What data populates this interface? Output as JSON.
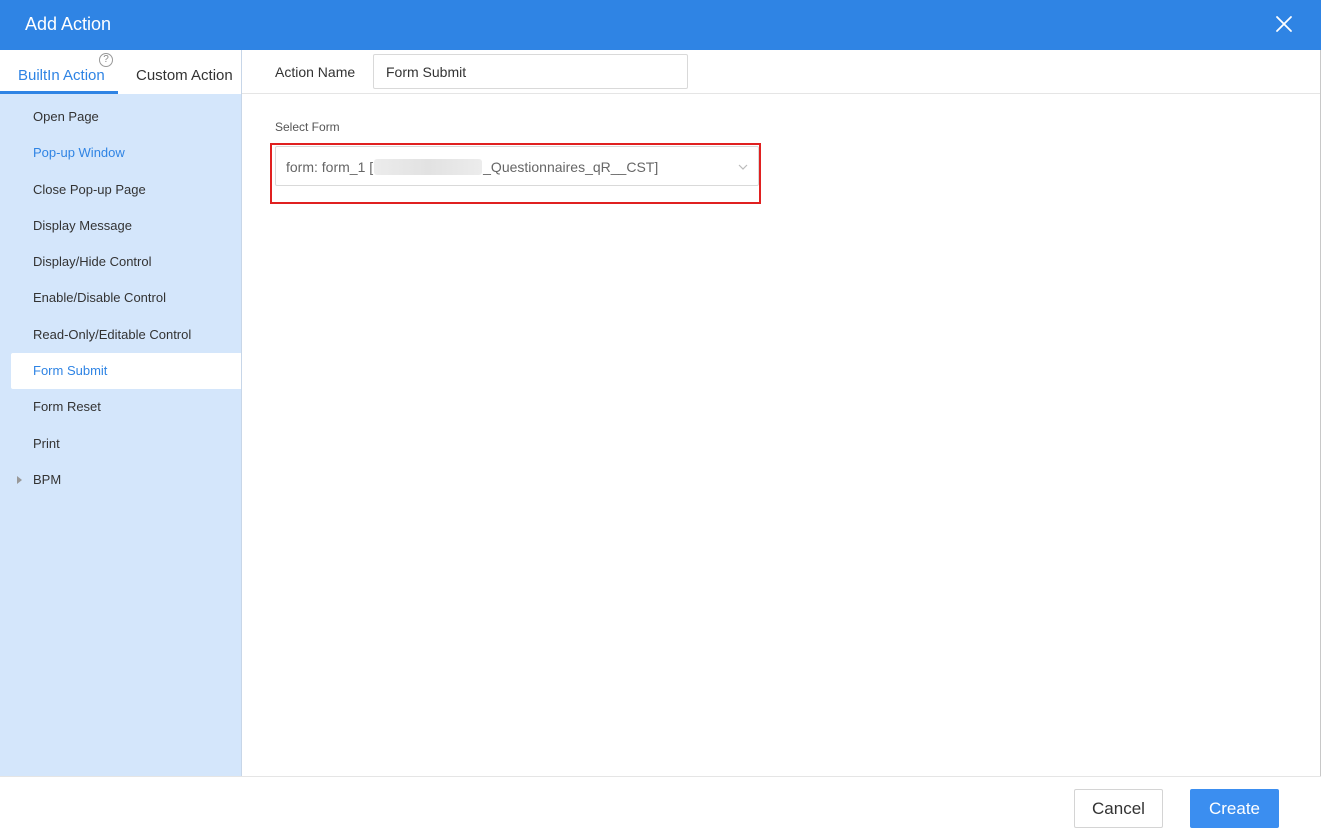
{
  "dialog": {
    "title": "Add Action",
    "close_icon": "close-icon"
  },
  "sidebar": {
    "tabs": [
      {
        "label": "BuiltIn Action",
        "active": true
      },
      {
        "label": "Custom Action",
        "active": false
      }
    ],
    "help_glyph": "?",
    "items": [
      {
        "label": "Open Page"
      },
      {
        "label": "Pop-up Window"
      },
      {
        "label": "Close Pop-up Page"
      },
      {
        "label": "Display Message"
      },
      {
        "label": "Display/Hide Control"
      },
      {
        "label": "Enable/Disable Control"
      },
      {
        "label": "Read-Only/Editable Control"
      },
      {
        "label": "Form Submit",
        "selected": true
      },
      {
        "label": "Form Reset"
      },
      {
        "label": "Print"
      },
      {
        "label": "BPM",
        "expandable": true
      }
    ]
  },
  "main": {
    "action_name_label": "Action Name",
    "action_name_value": "Form Submit",
    "select_form_label": "Select Form",
    "select_form_prefix": "form: form_1 [",
    "select_form_suffix": "_Questionnaires_qR__CST]"
  },
  "footer": {
    "cancel_label": "Cancel",
    "create_label": "Create"
  },
  "colors": {
    "header": "#2f84e4",
    "sidebar": "#d4e6fb",
    "accent": "#2f84e4",
    "highlight_border": "#e02020",
    "primary_button": "#3b8ef0"
  }
}
